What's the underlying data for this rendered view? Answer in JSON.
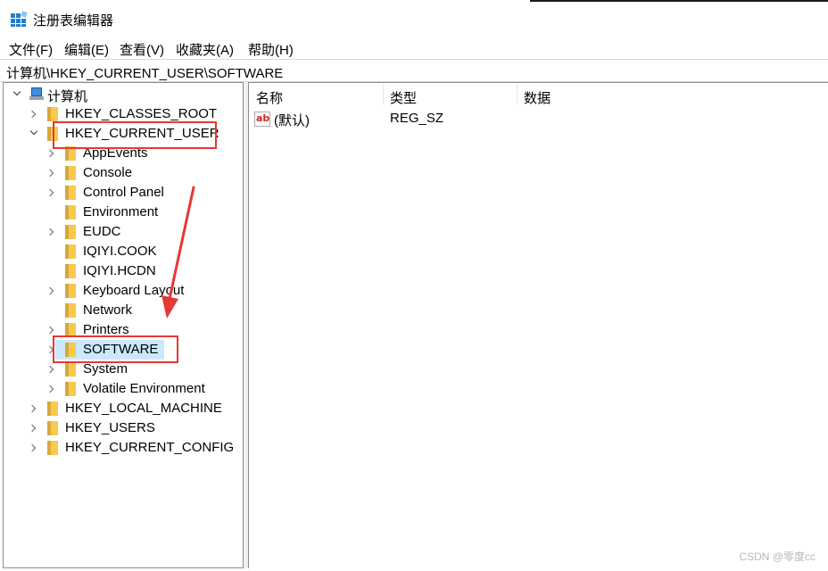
{
  "window": {
    "title": "注册表编辑器"
  },
  "menu": [
    "文件(F)",
    "编辑(E)",
    "查看(V)",
    "收藏夹(A)",
    "帮助(H)"
  ],
  "address": "计算机\\HKEY_CURRENT_USER\\SOFTWARE",
  "tree": {
    "root": "计算机",
    "hives": {
      "classes_root": "HKEY_CLASSES_ROOT",
      "current_user": "HKEY_CURRENT_USER",
      "local_machine": "HKEY_LOCAL_MACHINE",
      "users": "HKEY_USERS",
      "current_config": "HKEY_CURRENT_CONFIG"
    },
    "current_user_children": [
      "AppEvents",
      "Console",
      "Control Panel",
      "Environment",
      "EUDC",
      "IQIYI.COOK",
      "IQIYI.HCDN",
      "Keyboard Layout",
      "Network",
      "Printers",
      "SOFTWARE",
      "System",
      "Volatile Environment"
    ],
    "selected": "SOFTWARE"
  },
  "list": {
    "columns": [
      "名称",
      "类型",
      "数据"
    ],
    "rows": [
      {
        "name": "(默认)",
        "type": "REG_SZ",
        "data": ""
      }
    ]
  },
  "annotations": {
    "box_color": "#e53935",
    "arrow_color": "#e53935"
  },
  "watermark": "CSDN @零度cc",
  "colors": {
    "selection": "#cce8ff",
    "folder": "#f7c94e",
    "app_icon": "#1f7fd6"
  }
}
